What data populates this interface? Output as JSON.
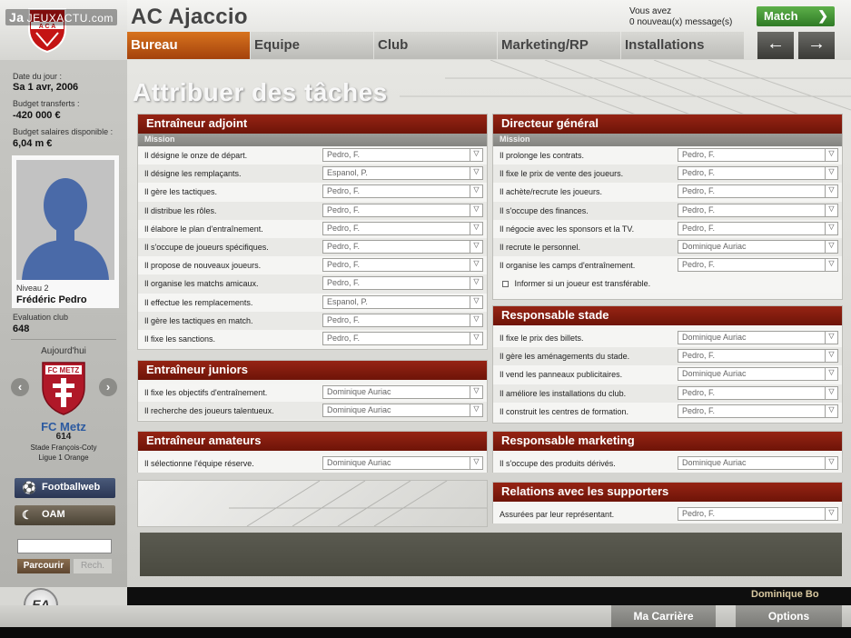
{
  "header": {
    "club_name": "AC Ajaccio",
    "watermark_brand": "Ja",
    "watermark_site": "JEUXACTU.com",
    "messages_line1": "Vous avez",
    "messages_line2": "0 nouveau(x) message(s)",
    "match_label": "Match",
    "tabs": [
      "Bureau",
      "Equipe",
      "Club",
      "Marketing/RP",
      "Installations"
    ],
    "active_tab": "Bureau"
  },
  "sidebar": {
    "date_label": "Date du jour :",
    "date_value": "Sa 1 avr, 2006",
    "transfer_label": "Budget transferts :",
    "transfer_value": "-420 000 €",
    "salary_label": "Budget salaires disponible :",
    "salary_value": "6,04 m €",
    "manager_level": "Niveau 2",
    "manager_name": "Frédéric Pedro",
    "eval_label": "Evaluation club",
    "eval_value": "648",
    "today_label": "Aujourd'hui",
    "opponent_name": "FC Metz",
    "opponent_eval": "614",
    "opponent_stadium": "Stade François-Coty",
    "opponent_league": "Ligue 1 Orange",
    "footballweb_label": "Footballweb",
    "oam_label": "OAM",
    "search_value": "",
    "browse_label": "Parcourir",
    "search_label": "Rech."
  },
  "main": {
    "title": "Attribuer des tâches",
    "mission_label": "Mission",
    "assistant": {
      "title": "Entraîneur adjoint",
      "rows": [
        {
          "task": "Il désigne le onze de départ.",
          "who": "Pedro, F."
        },
        {
          "task": "Il désigne les remplaçants.",
          "who": "Espanol, P."
        },
        {
          "task": "Il gère les tactiques.",
          "who": "Pedro, F."
        },
        {
          "task": "Il distribue les rôles.",
          "who": "Pedro, F."
        },
        {
          "task": "Il élabore le plan d'entraînement.",
          "who": "Pedro, F."
        },
        {
          "task": "Il s'occupe de joueurs spécifiques.",
          "who": "Pedro, F."
        },
        {
          "task": "Il propose de nouveaux joueurs.",
          "who": "Pedro, F."
        },
        {
          "task": "Il organise les matchs amicaux.",
          "who": "Pedro, F."
        },
        {
          "task": "Il effectue les remplacements.",
          "who": "Espanol, P."
        },
        {
          "task": "Il gère les tactiques en match.",
          "who": "Pedro, F."
        },
        {
          "task": "Il fixe les sanctions.",
          "who": "Pedro, F."
        }
      ]
    },
    "juniors": {
      "title": "Entraîneur juniors",
      "rows": [
        {
          "task": "Il fixe les objectifs d'entraînement.",
          "who": "Dominique Auriac"
        },
        {
          "task": "Il recherche des joueurs talentueux.",
          "who": "Dominique Auriac"
        }
      ]
    },
    "amateurs": {
      "title": "Entraîneur amateurs",
      "rows": [
        {
          "task": "Il sélectionne l'équipe réserve.",
          "who": "Dominique Auriac"
        }
      ]
    },
    "director": {
      "title": "Directeur général",
      "rows": [
        {
          "task": "Il prolonge les contrats.",
          "who": "Pedro, F."
        },
        {
          "task": "Il fixe le prix de vente des joueurs.",
          "who": "Pedro, F."
        },
        {
          "task": "Il achète/recrute les joueurs.",
          "who": "Pedro, F."
        },
        {
          "task": "Il s'occupe des finances.",
          "who": "Pedro, F."
        },
        {
          "task": "Il négocie avec les sponsors et la TV.",
          "who": "Pedro, F."
        },
        {
          "task": "Il recrute le personnel.",
          "who": "Dominique Auriac"
        },
        {
          "task": "Il organise les camps d'entraînement.",
          "who": "Pedro, F."
        }
      ],
      "checkbox_label": "Informer si un joueur est transférable."
    },
    "stadium": {
      "title": "Responsable stade",
      "rows": [
        {
          "task": "Il fixe le prix des billets.",
          "who": "Dominique Auriac"
        },
        {
          "task": "Il gère les aménagements du stade.",
          "who": "Pedro, F."
        },
        {
          "task": "Il vend les panneaux publicitaires.",
          "who": "Dominique Auriac"
        },
        {
          "task": "Il améliore les installations du club.",
          "who": "Pedro, F."
        },
        {
          "task": "Il construit les centres de formation.",
          "who": "Pedro, F."
        }
      ]
    },
    "marketing": {
      "title": "Responsable marketing",
      "rows": [
        {
          "task": "Il s'occupe des produits dérivés.",
          "who": "Dominique Auriac"
        }
      ]
    },
    "supporters": {
      "title": "Relations avec les supporters",
      "rows": [
        {
          "task": "Assurées par leur représentant.",
          "who": "Pedro, F."
        }
      ]
    }
  },
  "footer": {
    "user_name": "Dominique Bo",
    "career_label": "Ma Carrière",
    "options_label": "Options"
  }
}
